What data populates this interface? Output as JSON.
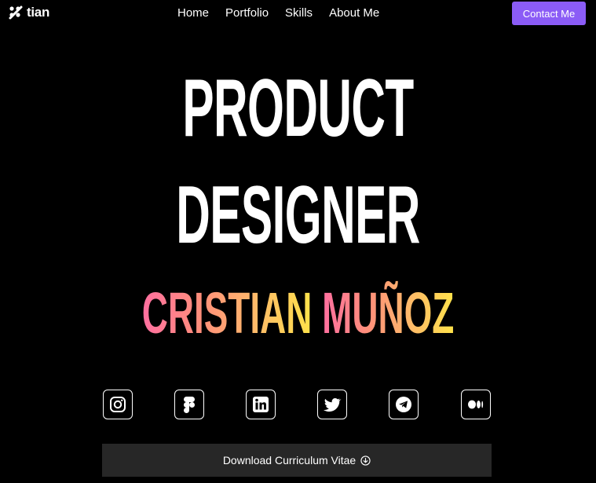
{
  "brand": {
    "logo_text": "tian"
  },
  "nav": {
    "items": [
      "Home",
      "Portfolio",
      "Skills",
      "About Me"
    ]
  },
  "contact": {
    "label": "Contact Me",
    "color": "#8b5cf6"
  },
  "hero": {
    "line1": "PRODUCT",
    "line2": "DESIGNER",
    "name_first": "CRISTIAN",
    "name_last": "MUÑOZ",
    "gradient": [
      "#ff6fa0",
      "#ffb86b",
      "#ffe24a"
    ]
  },
  "socials": [
    "instagram-icon",
    "figma-icon",
    "linkedin-icon",
    "twitter-icon",
    "telegram-icon",
    "medium-icon"
  ],
  "cv": {
    "label": "Download Curriculum Vitae"
  }
}
